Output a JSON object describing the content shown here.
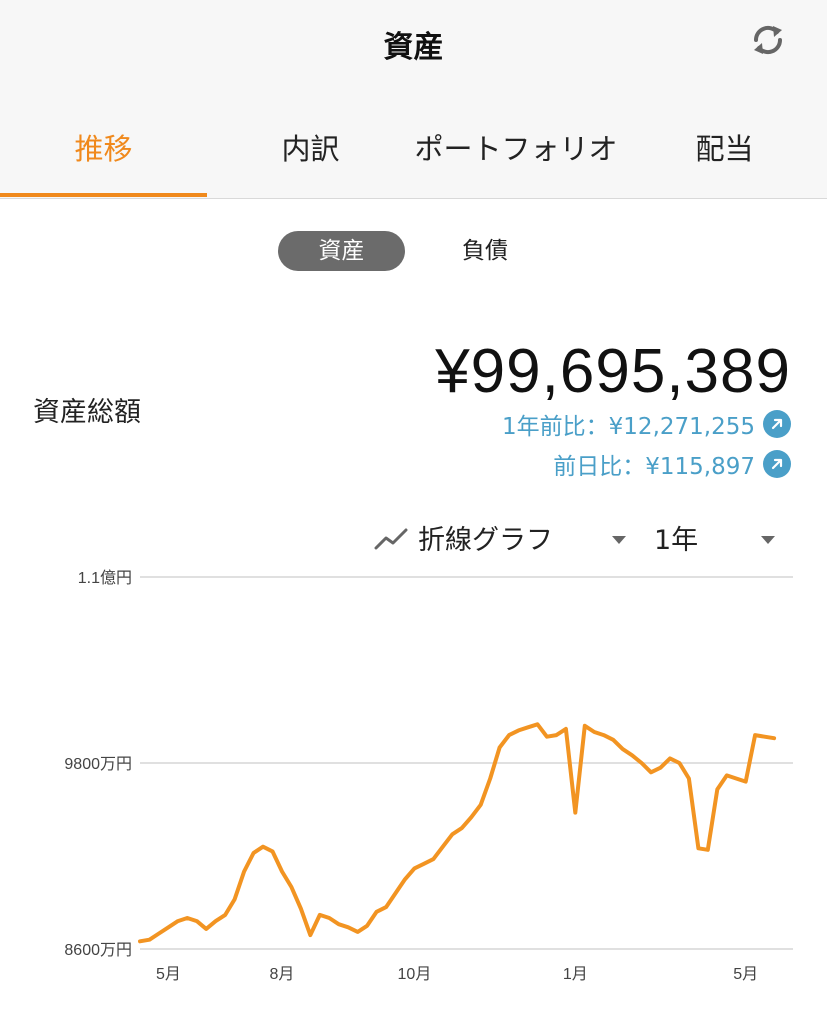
{
  "header": {
    "title": "資産",
    "refresh_icon": "refresh-icon"
  },
  "tabs": [
    {
      "label": "推移",
      "active": true
    },
    {
      "label": "内訳",
      "active": false
    },
    {
      "label": "ポートフォリオ",
      "active": false
    },
    {
      "label": "配当",
      "active": false
    }
  ],
  "segment": {
    "assets": "資産",
    "liabilities": "負債",
    "selected": "資産"
  },
  "summary": {
    "label": "資産総額",
    "total": "¥99,695,389",
    "year_change": "1年前比：¥12,271,255",
    "day_change": "前日比：¥115,897"
  },
  "controls": {
    "chart_type": "折線グラフ",
    "period": "1年",
    "chart_icon": "line-chart-icon"
  },
  "colors": {
    "accent": "#f0891c",
    "change": "#4a9fc8"
  },
  "chart_data": {
    "type": "line",
    "y_tick_labels": [
      "1.1億円",
      "9800万円",
      "8600万円"
    ],
    "y_ticks": [
      110000000,
      98000000,
      86000000
    ],
    "ylim": [
      86000000,
      110000000
    ],
    "x_tick_labels": [
      "5月",
      "8月",
      "10月",
      "1月",
      "5月"
    ],
    "x_tick_positions": [
      3,
      15,
      29,
      46,
      64
    ],
    "xlim": [
      0,
      69
    ],
    "grid": true,
    "series": [
      {
        "color": "#f29422",
        "values": [
          86500000,
          86600000,
          87000000,
          87400000,
          87800000,
          88000000,
          87800000,
          87300000,
          87800000,
          88200000,
          89200000,
          91000000,
          92200000,
          92600000,
          92300000,
          91000000,
          90000000,
          88600000,
          86900000,
          88200000,
          88000000,
          87600000,
          87400000,
          87100000,
          87500000,
          88400000,
          88700000,
          89600000,
          90500000,
          91200000,
          91500000,
          91800000,
          92600000,
          93400000,
          93800000,
          94500000,
          95300000,
          97000000,
          99000000,
          99800000,
          100100000,
          100300000,
          100500000,
          99700000,
          99800000,
          100200000,
          94800000,
          100400000,
          100000000,
          99800000,
          99500000,
          98900000,
          98500000,
          98000000,
          97400000,
          97700000,
          98300000,
          98000000,
          97000000,
          92500000,
          92400000,
          96300000,
          97200000,
          97000000,
          96800000,
          99800000,
          99700000,
          99600000
        ]
      }
    ]
  }
}
